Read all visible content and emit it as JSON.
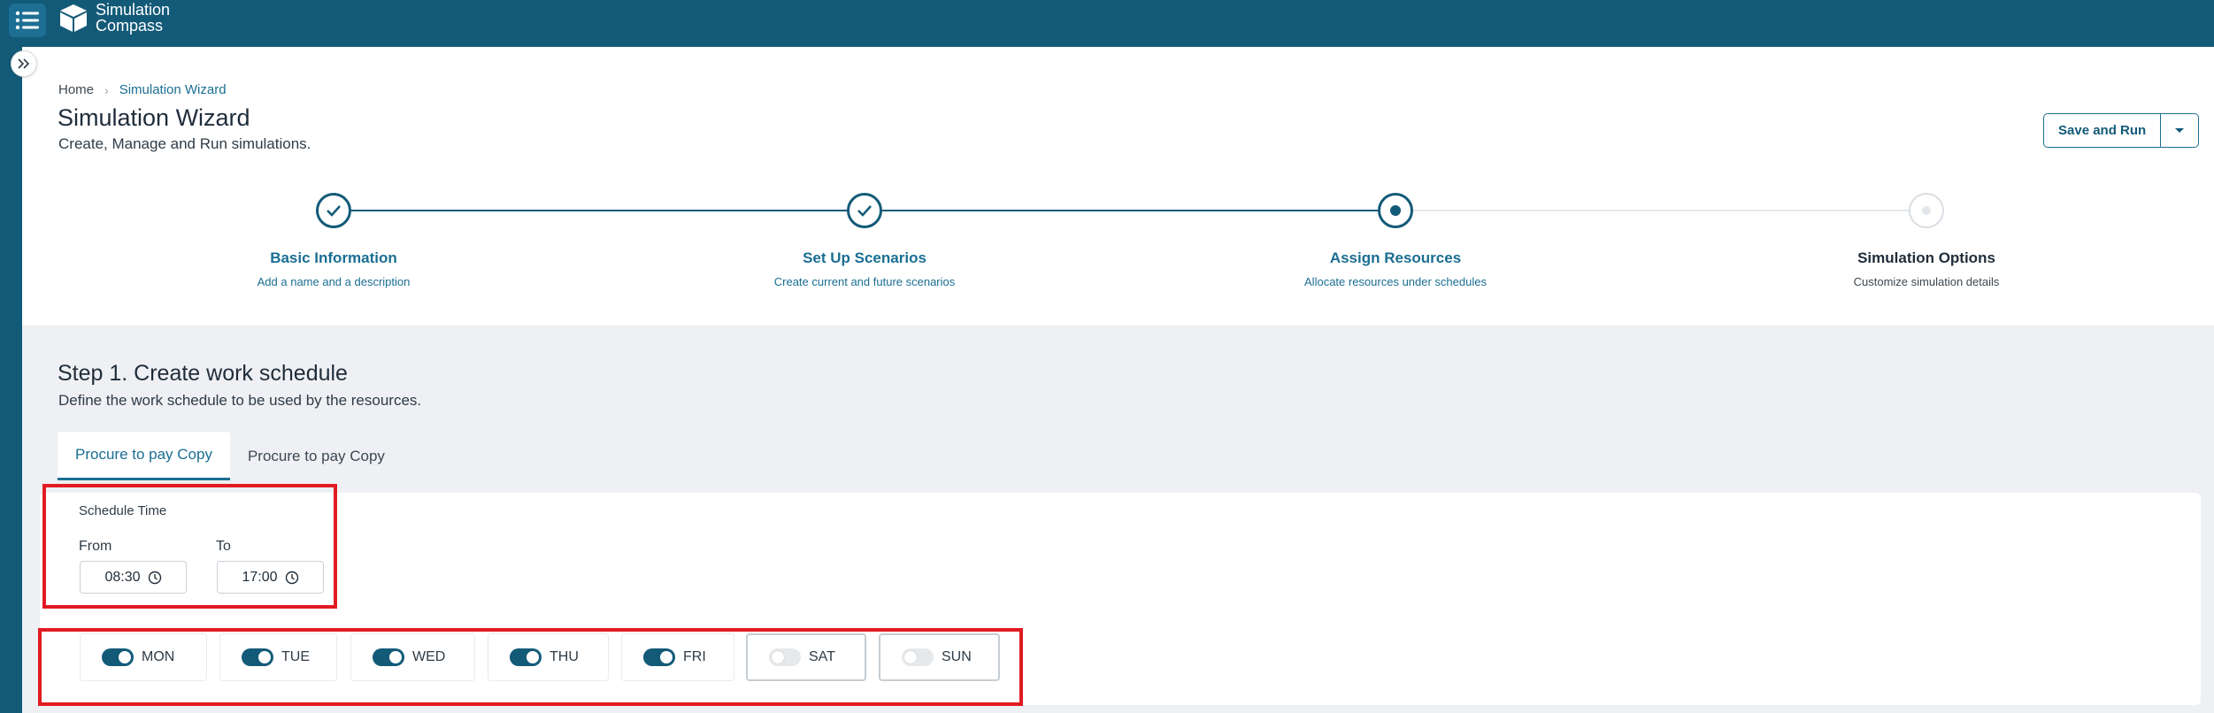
{
  "app": {
    "name_line1": "Simulation",
    "name_line2": "Compass"
  },
  "icons": {
    "menu": "list-menu-icon",
    "logo": "cube-logo-icon",
    "expand": "double-chevron-right-icon",
    "check": "check-icon",
    "clock": "clock-icon",
    "dropdown": "caret-down-icon"
  },
  "colors": {
    "brand": "#135a78",
    "accent": "#1a6e92",
    "highlight": "#e11b22"
  },
  "breadcrumb": {
    "home": "Home",
    "separator": "›",
    "current": "Simulation Wizard"
  },
  "header": {
    "title": "Simulation Wizard",
    "subtitle": "Create, Manage and Run simulations.",
    "save_label": "Save and Run"
  },
  "steps": [
    {
      "label": "Basic Information",
      "desc": "Add a name and a description",
      "status": "done"
    },
    {
      "label": "Set Up Scenarios",
      "desc": "Create current and future scenarios",
      "status": "done"
    },
    {
      "label": "Assign Resources",
      "desc": "Allocate resources under schedules",
      "status": "active"
    },
    {
      "label": "Simulation Options",
      "desc": "Customize simulation details",
      "status": "pending"
    }
  ],
  "section": {
    "title": "Step 1. Create work schedule",
    "subtitle": "Define the work schedule to be used by the resources."
  },
  "tabs": [
    {
      "label": "Procure to pay Copy",
      "active": true
    },
    {
      "label": "Procure to pay Copy",
      "active": false
    }
  ],
  "schedule": {
    "title": "Schedule Time",
    "from_label": "From",
    "to_label": "To",
    "from_value": "08:30",
    "to_value": "17:00"
  },
  "days": [
    {
      "label": "MON",
      "enabled": true
    },
    {
      "label": "TUE",
      "enabled": true
    },
    {
      "label": "WED",
      "enabled": true
    },
    {
      "label": "THU",
      "enabled": true
    },
    {
      "label": "FRI",
      "enabled": true
    },
    {
      "label": "SAT",
      "enabled": false
    },
    {
      "label": "SUN",
      "enabled": false
    }
  ]
}
